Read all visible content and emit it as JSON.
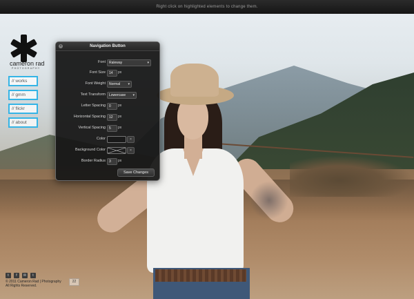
{
  "topbar": {
    "message": "Right click on highlighted elements to change them."
  },
  "logo": {
    "title": "cameron rad",
    "subtitle": "PHOTOGRAPHY"
  },
  "nav": [
    {
      "label": "// works"
    },
    {
      "label": "// gmm"
    },
    {
      "label": "// flickr"
    },
    {
      "label": "// about"
    }
  ],
  "dialog": {
    "title": "Navigation Button",
    "font": {
      "label": "Font",
      "value": "Raleway"
    },
    "font_size": {
      "label": "Font Size",
      "value": "14",
      "unit": "px"
    },
    "font_weight": {
      "label": "Font Weight",
      "value": "Normal"
    },
    "text_transform": {
      "label": "Text Transform",
      "value": "Lowercase"
    },
    "letter_spacing": {
      "label": "Letter Spacing",
      "value": "0",
      "unit": "px"
    },
    "horizontal_spacing": {
      "label": "Horizontal Spacing",
      "value": "12",
      "unit": "px"
    },
    "vertical_spacing": {
      "label": "Vertical Spacing",
      "value": "5",
      "unit": "px"
    },
    "color": {
      "label": "Color",
      "swatch": "#1a1a1a"
    },
    "background_color": {
      "label": "Background Color",
      "swatch": "transparent"
    },
    "border_radius": {
      "label": "Border Radius",
      "value": "3",
      "unit": "px"
    },
    "save_label": "Save Changes",
    "close_glyph": "×",
    "clear_glyph": "×",
    "dropdown_glyph": "▾"
  },
  "footer": {
    "icons": [
      "twitter-icon",
      "facebook-icon",
      "email-icon",
      "tumblr-icon"
    ],
    "icon_glyphs": [
      "t",
      "f",
      "✉",
      "t"
    ],
    "copyright": "© 2011 Cameron Rad | Photography",
    "rights": "All Rights Reserved.",
    "badge": "22"
  },
  "colors": {
    "accent": "#34b4e6",
    "dialog_bg": "#161616"
  }
}
